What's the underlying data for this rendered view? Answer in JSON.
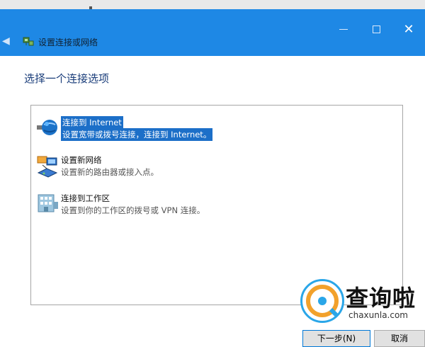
{
  "window": {
    "title": "设置连接或网络",
    "caption": {
      "minimize": "—",
      "maximize": "☐",
      "close": "✕"
    },
    "colors": {
      "titlebar": "#1e88e5",
      "selection": "#1c6fc8"
    },
    "icons": [
      "back-arrow-icon",
      "network-setup-icon"
    ]
  },
  "main": {
    "heading": "选择一个连接选项",
    "options": [
      {
        "title": "连接到 Internet",
        "description": "设置宽带或拨号连接，连接到 Internet。",
        "icon": "globe-icon",
        "selected": true
      },
      {
        "title": "设置新网络",
        "description": "设置新的路由器或接入点。",
        "icon": "router-icon",
        "selected": false
      },
      {
        "title": "连接到工作区",
        "description": "设置到你的工作区的拨号或 VPN 连接。",
        "icon": "workplace-icon",
        "selected": false
      }
    ]
  },
  "footer": {
    "next_label": "下一步(N)",
    "cancel_label": "取消"
  },
  "watermark": {
    "title": "查询啦",
    "url": "chaxunla.com"
  }
}
